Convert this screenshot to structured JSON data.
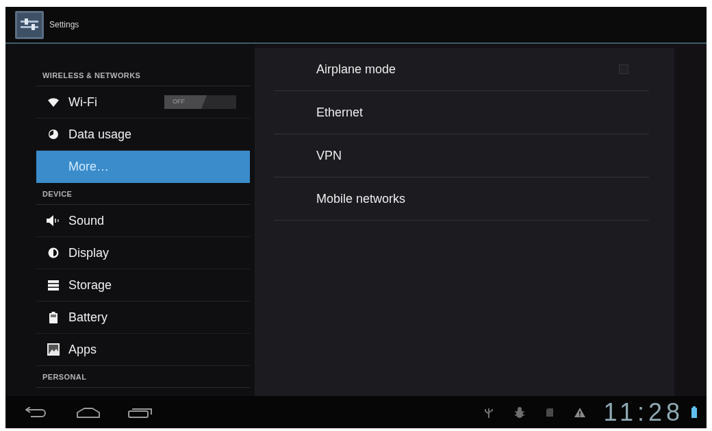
{
  "window": {
    "title": "Settings"
  },
  "sidebar": {
    "sections": [
      {
        "header": "WIRELESS & NETWORKS",
        "items": [
          {
            "label": "Wi-Fi",
            "selected": false,
            "toggle": {
              "label": "OFF",
              "on": false
            }
          },
          {
            "label": "Data usage",
            "selected": false
          },
          {
            "label": "More…",
            "selected": true
          }
        ]
      },
      {
        "header": "DEVICE",
        "items": [
          {
            "label": "Sound",
            "selected": false
          },
          {
            "label": "Display",
            "selected": false
          },
          {
            "label": "Storage",
            "selected": false
          },
          {
            "label": "Battery",
            "selected": false
          },
          {
            "label": "Apps",
            "selected": false
          }
        ]
      },
      {
        "header": "PERSONAL"
      }
    ]
  },
  "content": {
    "items": [
      {
        "label": "Airplane mode",
        "kind": "checkbox",
        "checked": false
      },
      {
        "label": "Ethernet",
        "kind": "plain"
      },
      {
        "label": "VPN",
        "kind": "plain"
      },
      {
        "label": "Mobile networks",
        "kind": "plain"
      }
    ]
  },
  "status_bar": {
    "time": "11:28"
  }
}
